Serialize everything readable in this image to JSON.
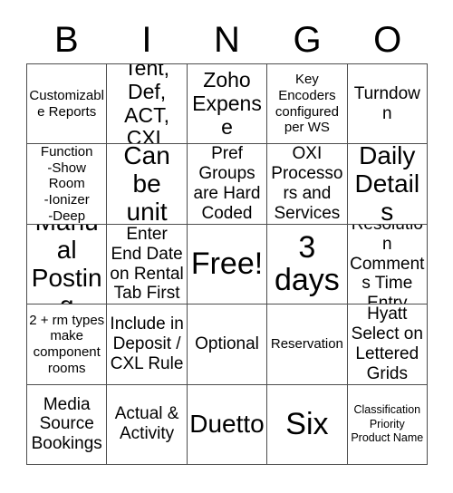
{
  "card": {
    "title": "BINGO",
    "header_letters": [
      "B",
      "I",
      "N",
      "G",
      "O"
    ],
    "colors": {
      "background": "#ffffff",
      "text": "#000000",
      "grid_line": "#4d4d4d"
    },
    "grid": {
      "rows": 5,
      "columns": 5,
      "free_space_index": 12
    },
    "cells": [
      {
        "text": "Customizable Reports",
        "size": "sm",
        "free": false
      },
      {
        "text": "Tent, Def, ACT, CXL",
        "size": "lg",
        "free": false
      },
      {
        "text": "Zoho Expense",
        "size": "lg",
        "free": false
      },
      {
        "text": "Key Encoders configured per WS",
        "size": "sm",
        "free": false
      },
      {
        "text": "Turndown",
        "size": "md",
        "free": false
      },
      {
        "text": "-Sp Function\n-Show Room\n-Ionizer\n-Deep Clean",
        "size": "sm",
        "free": false
      },
      {
        "text": "Can be unit",
        "size": "xl",
        "free": false
      },
      {
        "text": "Pref Groups are Hard Coded",
        "size": "md",
        "free": false
      },
      {
        "text": "OXI Processors and Services",
        "size": "md",
        "free": false
      },
      {
        "text": "Daily Details",
        "size": "xl",
        "free": false
      },
      {
        "text": "Manual Posting",
        "size": "xl",
        "free": false
      },
      {
        "text": "Enter End Date on Rental Tab First",
        "size": "md",
        "free": false
      },
      {
        "text": "Free!",
        "size": "xxl",
        "free": true
      },
      {
        "text": "3 days",
        "size": "xxl",
        "free": false
      },
      {
        "text": "Resolution Comments Time Entry",
        "size": "md",
        "free": false
      },
      {
        "text": "2 + rm types make component rooms",
        "size": "sm",
        "free": false
      },
      {
        "text": "Include in Deposit / CXL Rule",
        "size": "md",
        "free": false
      },
      {
        "text": "Optional",
        "size": "md",
        "free": false
      },
      {
        "text": "Reservation",
        "size": "sm",
        "free": false
      },
      {
        "text": "Hyatt Select on Lettered Grids",
        "size": "md",
        "free": false
      },
      {
        "text": "Media Source Bookings",
        "size": "md",
        "free": false
      },
      {
        "text": "Actual & Activity",
        "size": "md",
        "free": false
      },
      {
        "text": "Duetto",
        "size": "xl",
        "free": false
      },
      {
        "text": "Six",
        "size": "xxl",
        "free": false
      },
      {
        "text": "Classification Priority Product Name",
        "size": "xs",
        "free": false
      }
    ]
  }
}
